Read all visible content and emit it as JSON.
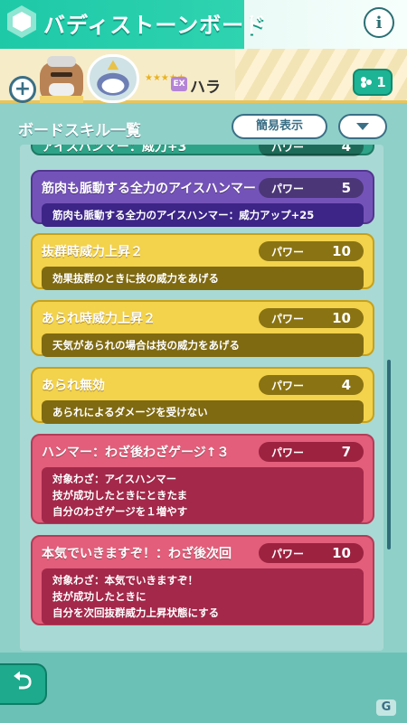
{
  "header": {
    "title": "バディストーンボード"
  },
  "trainer": {
    "name": "ハラ",
    "stars": "★★★★★",
    "badge": "EX"
  },
  "sync": {
    "count": "1"
  },
  "list": {
    "title": "ボードスキル一覧",
    "simple_label": "簡易表示",
    "power_label": "パワー"
  },
  "skills": [
    {
      "name": "アイスハンマー：威力+3",
      "power": "4",
      "color": "teal",
      "desc": []
    },
    {
      "name": "筋肉も脈動する全力のアイスハンマー",
      "power": "5",
      "color": "purple",
      "desc": [
        "筋肉も脈動する全力のアイスハンマー：威力アップ+25"
      ]
    },
    {
      "name": "抜群時威力上昇２",
      "power": "10",
      "color": "yellow",
      "desc": [
        "効果抜群のときに技の威力をあげる"
      ]
    },
    {
      "name": "あられ時威力上昇２",
      "power": "10",
      "color": "yellow",
      "desc": [
        "天気があられの場合は技の威力をあげる"
      ]
    },
    {
      "name": "あられ無効",
      "power": "4",
      "color": "yellow",
      "desc": [
        "あられによるダメージを受けない"
      ]
    },
    {
      "name": "ハンマー：わざ後わざゲージ↑３",
      "power": "7",
      "color": "red",
      "desc": [
        "対象わざ：アイスハンマー",
        "技が成功したときにときたま",
        "自分のわざゲージを１増やす"
      ]
    },
    {
      "name": "本気でいきますぞ！：わざ後次回",
      "power": "10",
      "color": "red",
      "desc": [
        "対象わざ：本気でいきますぞ！",
        "技が成功したときに",
        "自分を次回抜群威力上昇状態にする"
      ]
    }
  ],
  "colors": {
    "teal": "#2fa387",
    "purple": "#7453b9",
    "yellow": "#f3d24c",
    "red": "#e25e7a"
  },
  "icons": {
    "logo": "hexagon-logo-icon",
    "info": "info-icon",
    "add": "plus-icon",
    "sync": "buddy-group-icon",
    "back": "back-arrow-icon",
    "dropdown": "chevron-down-icon"
  }
}
